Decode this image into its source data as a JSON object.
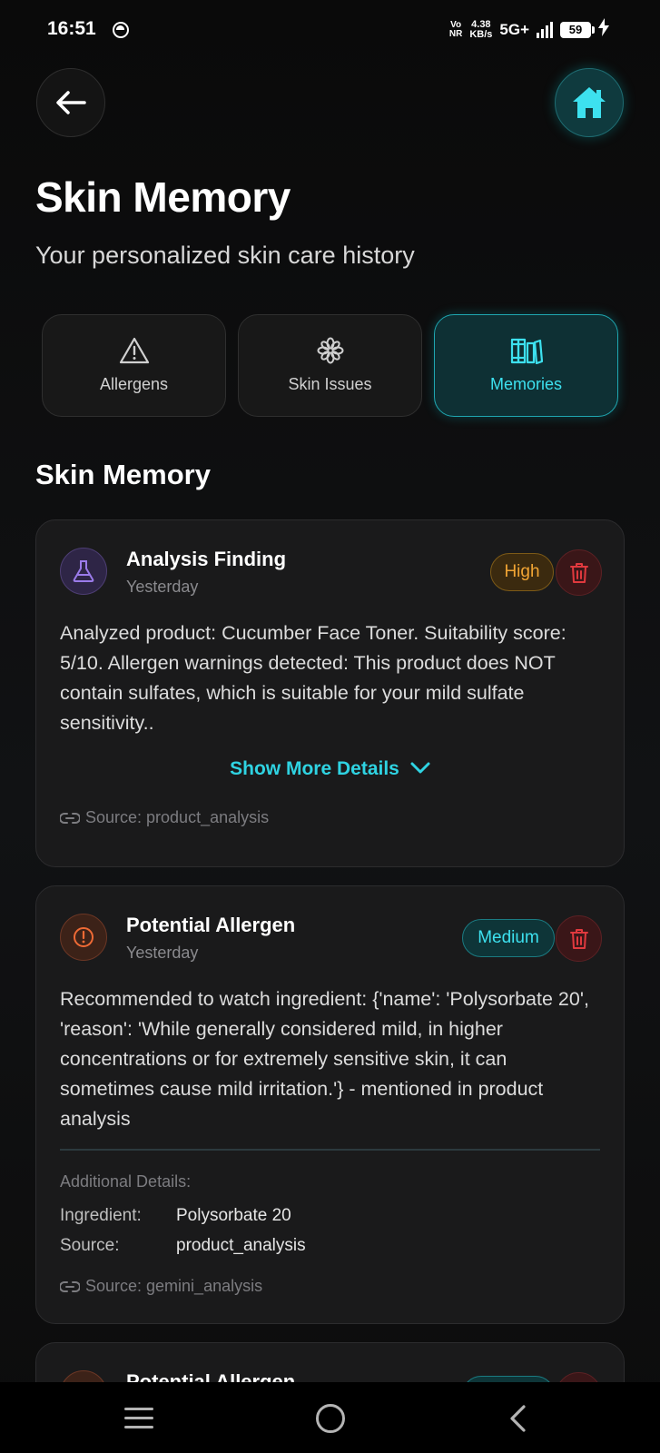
{
  "status_bar": {
    "time": "16:51",
    "network_vo": "Vo",
    "network_nr": "NR",
    "speed_value": "4.38",
    "speed_unit": "KB/s",
    "network_type": "5G+",
    "battery": "59"
  },
  "header": {
    "title": "Skin Memory",
    "subtitle": "Your personalized skin care history"
  },
  "tabs": [
    {
      "label": "Allergens",
      "icon": "warning-triangle-icon",
      "active": false
    },
    {
      "label": "Skin Issues",
      "icon": "asterisk-flower-icon",
      "active": false
    },
    {
      "label": "Memories",
      "icon": "books-icon",
      "active": true
    }
  ],
  "section_title": "Skin Memory",
  "cards": [
    {
      "icon": "flask-icon",
      "title": "Analysis Finding",
      "date": "Yesterday",
      "badge": "High",
      "body": "Analyzed product: Cucumber Face Toner. Suitability score: 5/10. Allergen warnings detected: This product does NOT contain sulfates, which is suitable for your mild sulfate sensitivity..",
      "show_more": "Show More Details",
      "source": "Source: product_analysis"
    },
    {
      "icon": "alert-circle-icon",
      "title": "Potential Allergen",
      "date": "Yesterday",
      "badge": "Medium",
      "body": "Recommended to watch ingredient: {'name': 'Polysorbate 20', 'reason': 'While generally considered mild, in higher concentrations or for extremely sensitive skin, it can sometimes cause mild irritation.'} - mentioned in product analysis",
      "details_label": "Additional Details:",
      "details": [
        {
          "key": "Ingredient:",
          "value": "Polysorbate 20"
        },
        {
          "key": "Source:",
          "value": "product_analysis"
        }
      ],
      "source": "Source: gemini_analysis"
    },
    {
      "title": "Potential Allergen"
    }
  ],
  "colors": {
    "accent": "#2fd3e2",
    "high": "#f2a534",
    "delete": "#e0393e",
    "background": "#0e0e0f"
  }
}
